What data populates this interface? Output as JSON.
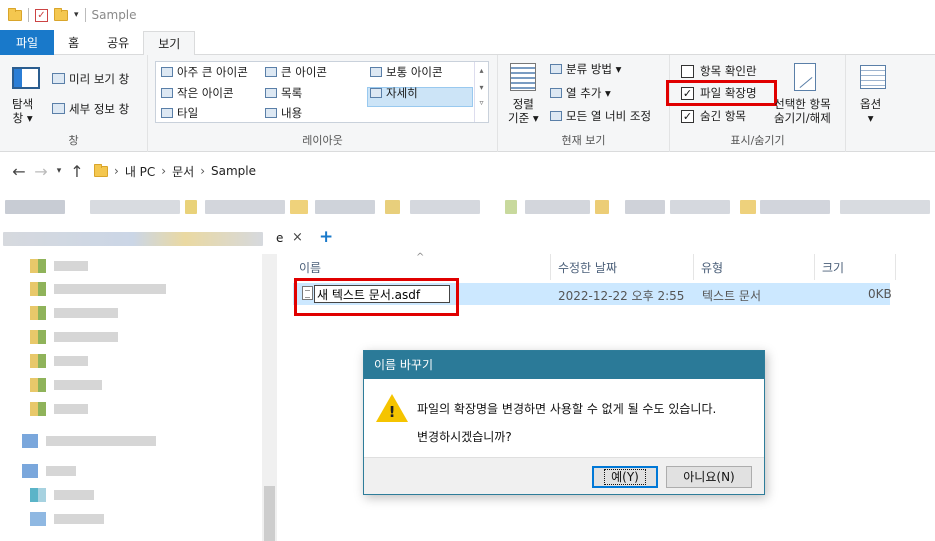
{
  "window": {
    "title": "Sample"
  },
  "ribbon_tabs": [
    "파일",
    "홈",
    "공유",
    "보기"
  ],
  "ribbon": {
    "pane_group": {
      "nav_pane_label": "탐색\n창 ▾",
      "preview_pane": "미리 보기 창",
      "details_pane": "세부 정보 창",
      "group_label": "창"
    },
    "layout_group": {
      "items": [
        "아주 큰 아이콘",
        "큰 아이콘",
        "보통 아이콘",
        "작은 아이콘",
        "목록",
        "자세히",
        "타일",
        "내용"
      ],
      "selected": "자세히",
      "group_label": "레이아웃"
    },
    "current_view_group": {
      "sort_label": "정렬\n기준 ▾",
      "group_by": "분류 방법 ▾",
      "add_columns": "열 추가 ▾",
      "size_all_columns": "모든 열 너비 조정",
      "group_label": "현재 보기"
    },
    "show_hide_group": {
      "item_checkboxes": {
        "label": "항목 확인란",
        "checked": false
      },
      "file_extensions": {
        "label": "파일 확장명",
        "checked": true
      },
      "hidden_items": {
        "label": "숨긴 항목",
        "checked": true
      },
      "hide_selected": "선택한 항목\n숨기기/해제",
      "group_label": "표시/숨기기"
    },
    "options": {
      "label": "옵션\n▾"
    }
  },
  "address": {
    "crumbs": [
      "내 PC",
      "문서",
      "Sample"
    ]
  },
  "tabbar": {
    "partial_text": "e",
    "close": "×",
    "add": "+"
  },
  "columns": {
    "name": "이름",
    "modified": "수정한 날짜",
    "type": "유형",
    "size": "크기"
  },
  "file": {
    "rename_value": "새 텍스트 문서.asdf",
    "modified": "2022-12-22 오후 2:55",
    "type": "텍스트 문서",
    "size": "0KB"
  },
  "dialog": {
    "title": "이름 바꾸기",
    "message": "파일의 확장명을 변경하면 사용할 수 없게 될 수도 있습니다.",
    "question": "변경하시겠습니까?",
    "yes": "예(Y)",
    "no": "아니요(N)"
  },
  "colors": {
    "accent": "#1979ca",
    "dialog_title": "#2b7a98",
    "highlight": "#e00000",
    "selection": "#cce8ff"
  }
}
